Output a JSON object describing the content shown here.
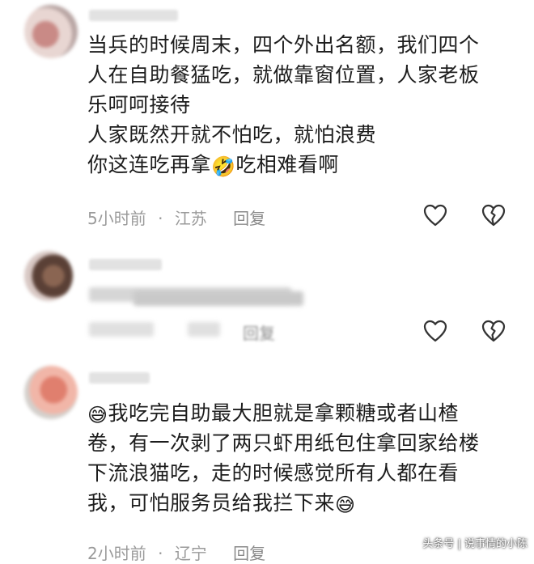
{
  "comments": [
    {
      "lines": [
        "当兵的时候周末，四个外出名额，我们四个",
        "人在自助餐猛吃，就做靠窗位置，人家老板",
        "乐呵呵接待",
        "人家既然开就不怕吃，就怕浪费"
      ],
      "last_line_before": "你这连吃再拿",
      "last_line_emoji": "🤣",
      "last_line_after": "吃相难看啊",
      "time": "5小时前",
      "location": "江苏",
      "reply": "回复",
      "like_icon": "heart-outline-icon",
      "dislike_icon": "broken-heart-icon"
    },
    {
      "reply": "回复",
      "like_icon": "heart-outline-icon",
      "dislike_icon": "broken-heart-icon"
    },
    {
      "first_emoji": "😅",
      "first_line": "我吃完自助最大胆就是拿颗糖或者山楂",
      "lines": [
        "卷，有一次剥了两只虾用纸包住拿回家给楼",
        "下流浪猫吃，走的时候感觉所有人都在看"
      ],
      "last_line": "我，可怕服务员给我拦下来",
      "last_emoji": "😅",
      "time": "2小时前",
      "location": "辽宁",
      "reply": "回复"
    }
  ],
  "separator": "·",
  "watermark": "头条号 | 说事情的小陈"
}
